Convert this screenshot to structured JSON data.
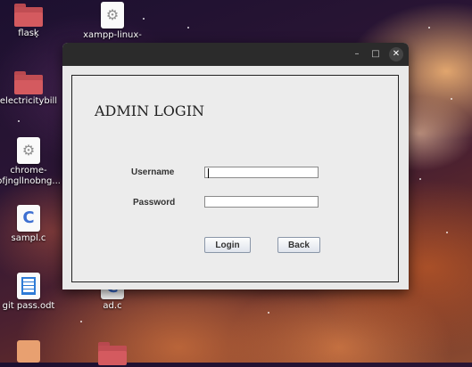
{
  "desktop": {
    "icons": [
      {
        "label": "flask",
        "icon": "folder-icon"
      },
      {
        "label": "xampp-linux-",
        "icon": "gear-icon"
      },
      {
        "label": "electricitybill",
        "icon": "folder-icon"
      },
      {
        "label": "chrome-",
        "label2": "pfjngllnobng...",
        "icon": "gear-icon"
      },
      {
        "label": "sampl.c",
        "icon": "c-file-icon"
      },
      {
        "label": "git pass.odt",
        "icon": "document-icon"
      },
      {
        "label": "ad.c",
        "icon": "c-file-icon"
      }
    ]
  },
  "window": {
    "controls": {
      "minimize": "–",
      "maximize": "□",
      "close": "✕"
    },
    "title": "ADMIN LOGIN",
    "username_label": "Username",
    "password_label": "Password",
    "username_value": "",
    "password_value": "",
    "login_label": "Login",
    "back_label": "Back"
  }
}
